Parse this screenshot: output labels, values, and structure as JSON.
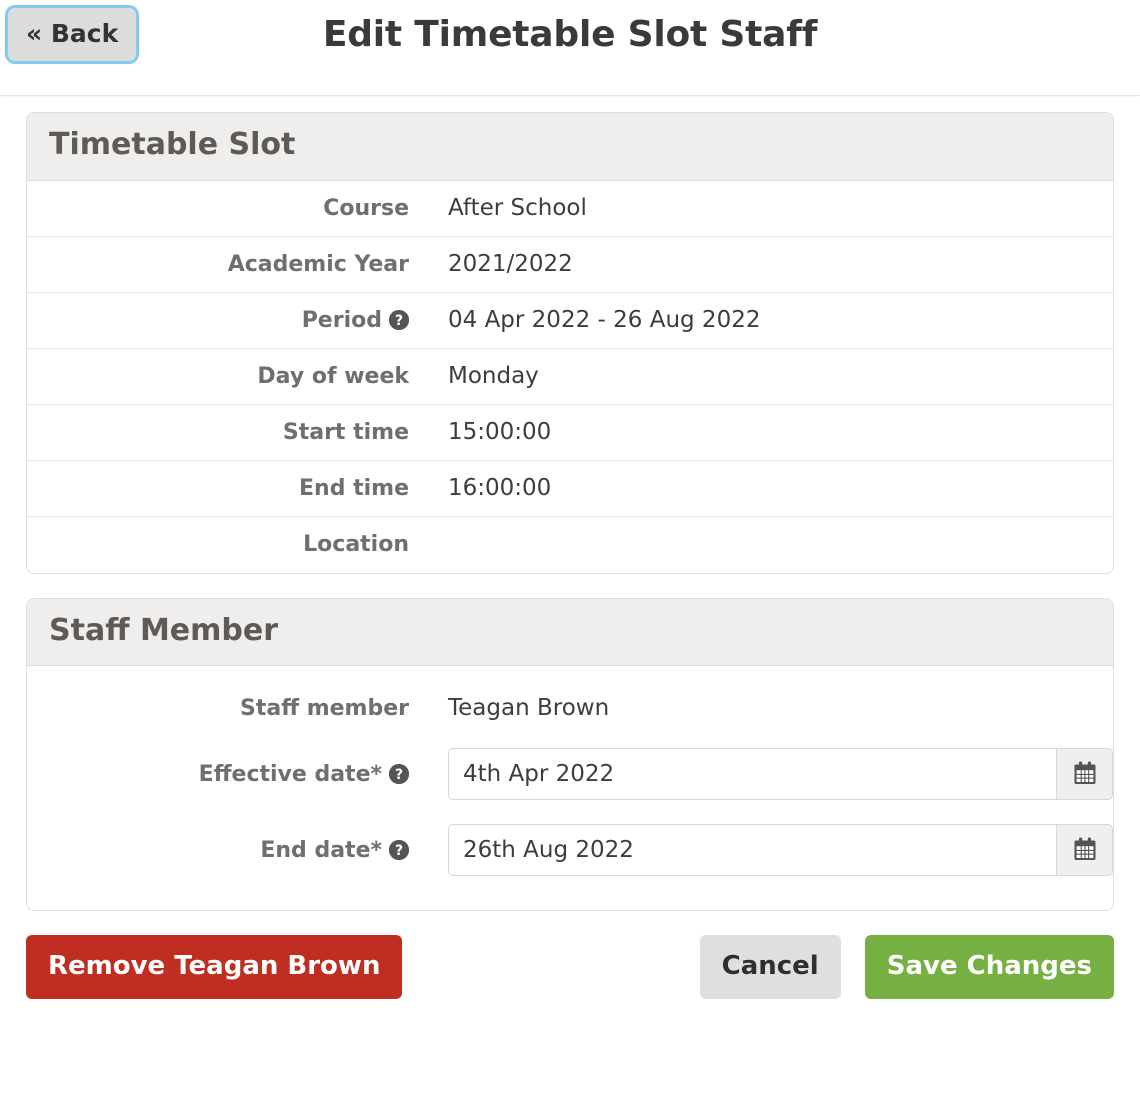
{
  "header": {
    "back_label": "« Back",
    "title": "Edit Timetable Slot Staff"
  },
  "timetable_slot": {
    "panel_title": "Timetable Slot",
    "rows": [
      {
        "label": "Course",
        "value": "After School",
        "help": false
      },
      {
        "label": "Academic Year",
        "value": "2021/2022",
        "help": false
      },
      {
        "label": "Period",
        "value": "04 Apr 2022 - 26 Aug 2022",
        "help": true
      },
      {
        "label": "Day of week",
        "value": "Monday",
        "help": false
      },
      {
        "label": "Start time",
        "value": "15:00:00",
        "help": false
      },
      {
        "label": "End time",
        "value": "16:00:00",
        "help": false
      },
      {
        "label": "Location",
        "value": "",
        "help": false
      }
    ]
  },
  "staff_member": {
    "panel_title": "Staff Member",
    "staff_label": "Staff member",
    "staff_value": "Teagan Brown",
    "effective_date": {
      "label": "Effective date*",
      "value": "4th Apr 2022",
      "calendar_icon": "calendar-icon",
      "help": true
    },
    "end_date": {
      "label": "End date*",
      "value": "26th Aug 2022",
      "calendar_icon": "calendar-icon",
      "help": true
    }
  },
  "footer": {
    "remove_label": "Remove Teagan Brown",
    "cancel_label": "Cancel",
    "save_label": "Save Changes"
  },
  "colors": {
    "danger": "#bf2e20",
    "success": "#76b043",
    "default": "#e0dfdd",
    "panel_header": "#efeeec",
    "focus_ring": "#7ecdea"
  }
}
